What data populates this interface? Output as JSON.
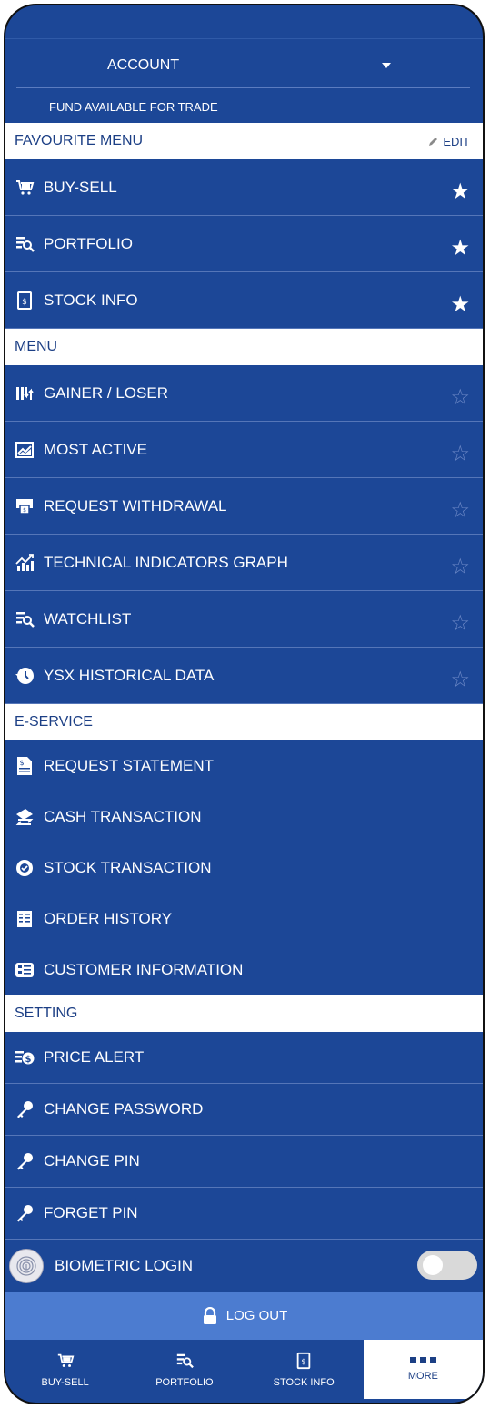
{
  "account": {
    "label": "ACCOUNT",
    "fund_label": "FUND AVAILABLE FOR TRADE"
  },
  "favourite": {
    "title": "FAVOURITE MENU",
    "edit_label": "EDIT",
    "items": [
      {
        "label": "BUY-SELL",
        "icon": "cart-icon",
        "starred": true
      },
      {
        "label": "PORTFOLIO",
        "icon": "portfolio-icon",
        "starred": true
      },
      {
        "label": "STOCK INFO",
        "icon": "stock-info-icon",
        "starred": true
      }
    ]
  },
  "menu": {
    "title": "MENU",
    "items": [
      {
        "label": "GAINER / LOSER",
        "icon": "gainer-loser-icon",
        "starred": false
      },
      {
        "label": "MOST ACTIVE",
        "icon": "chart-icon",
        "starred": false
      },
      {
        "label": "REQUEST WITHDRAWAL",
        "icon": "atm-icon",
        "starred": false
      },
      {
        "label": "TECHNICAL INDICATORS GRAPH",
        "icon": "graph-icon",
        "starred": false
      },
      {
        "label": "WATCHLIST",
        "icon": "watchlist-icon",
        "starred": false
      },
      {
        "label": "YSX HISTORICAL DATA",
        "icon": "history-icon",
        "starred": false
      }
    ]
  },
  "eservice": {
    "title": "E-SERVICE",
    "items": [
      {
        "label": "REQUEST STATEMENT",
        "icon": "statement-icon"
      },
      {
        "label": "CASH TRANSACTION",
        "icon": "cash-icon"
      },
      {
        "label": "STOCK TRANSACTION",
        "icon": "stock-transaction-icon"
      },
      {
        "label": "ORDER HISTORY",
        "icon": "order-history-icon"
      },
      {
        "label": "CUSTOMER INFORMATION",
        "icon": "customer-info-icon"
      }
    ]
  },
  "setting": {
    "title": "SETTING",
    "items": [
      {
        "label": "PRICE ALERT",
        "icon": "price-alert-icon"
      },
      {
        "label": "CHANGE PASSWORD",
        "icon": "key-icon"
      },
      {
        "label": "CHANGE PIN",
        "icon": "key-icon"
      },
      {
        "label": "FORGET PIN",
        "icon": "key-icon"
      }
    ],
    "biometric_label": "BIOMETRIC LOGIN",
    "biometric_enabled": false
  },
  "logout_label": "LOG OUT",
  "tabs": [
    {
      "label": "BUY-SELL"
    },
    {
      "label": "PORTFOLIO"
    },
    {
      "label": "STOCK INFO"
    },
    {
      "label": "MORE",
      "active": true
    }
  ],
  "colors": {
    "primary": "#1c4797",
    "logout": "#4c7cd0",
    "section_bg": "#ffffff"
  }
}
